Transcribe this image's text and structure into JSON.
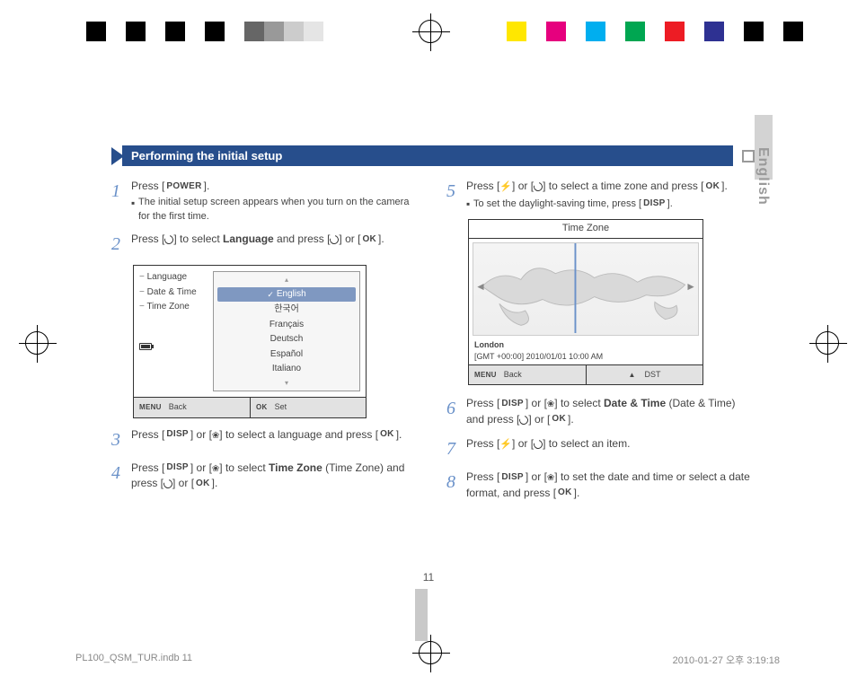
{
  "meta": {
    "side_language_tab": "English",
    "page_number": "11",
    "footer_file": "PL100_QSM_TUR.indb   11",
    "footer_date": "2010-01-27   오후 3:19:18"
  },
  "header": {
    "title": "Performing the initial setup"
  },
  "icons": {
    "power": "POWER",
    "ok": "OK",
    "disp": "DISP",
    "menu": "MENU",
    "back_label": "Back",
    "set_label": "Set",
    "dst_label": "DST"
  },
  "steps": {
    "s1": {
      "num": "1",
      "text_a": "Press [",
      "text_b": "].",
      "sub1_a": "The initial setup screen appears when you turn on the camera for the first time."
    },
    "s2": {
      "num": "2",
      "text_a": "Press [",
      "text_b": "] to select ",
      "bold1": "Language",
      "text_c": " and press [",
      "text_d": "] or [",
      "text_e": "]."
    },
    "s3": {
      "num": "3",
      "text_a": "Press [",
      "text_b": "] or [",
      "text_c": "] to select a language and press [",
      "text_d": "]."
    },
    "s4": {
      "num": "4",
      "text_a": "Press [",
      "text_b": "] or [",
      "text_c": "] to select ",
      "bold1": "Time Zone",
      "text_d": " (Time Zone) and press [",
      "text_e": "] or [",
      "text_f": "]."
    },
    "s5": {
      "num": "5",
      "text_a": "Press [",
      "text_b": "] or [",
      "text_c": "] to select a time zone and press [",
      "text_d": "].",
      "sub1_a": "To set the daylight-saving time, press [",
      "sub1_b": "]."
    },
    "s6": {
      "num": "6",
      "text_a": "Press [",
      "text_b": "] or [",
      "text_c": "] to select ",
      "bold1": "Date & Time",
      "text_d": " (Date & Time) and press [",
      "text_e": "] or [",
      "text_f": "]."
    },
    "s7": {
      "num": "7",
      "text_a": "Press [",
      "text_b": "] or [",
      "text_c": "] to select an item."
    },
    "s8": {
      "num": "8",
      "text_a": "Press [",
      "text_b": "] or [",
      "text_c": "] to set the date and time or select a date format, and press [",
      "text_d": "]."
    }
  },
  "lang_screenshot": {
    "menu": {
      "language": "Language",
      "datetime": "Date & Time",
      "timezone": "Time Zone"
    },
    "options": {
      "english": "English",
      "korean": "한국어",
      "francais": "Français",
      "deutsch": "Deutsch",
      "espanol": "Español",
      "italiano": "Italiano"
    }
  },
  "tz_screenshot": {
    "title": "Time Zone",
    "city": "London",
    "gmt": "[GMT +00:00] 2010/01/01 10:00 AM"
  }
}
